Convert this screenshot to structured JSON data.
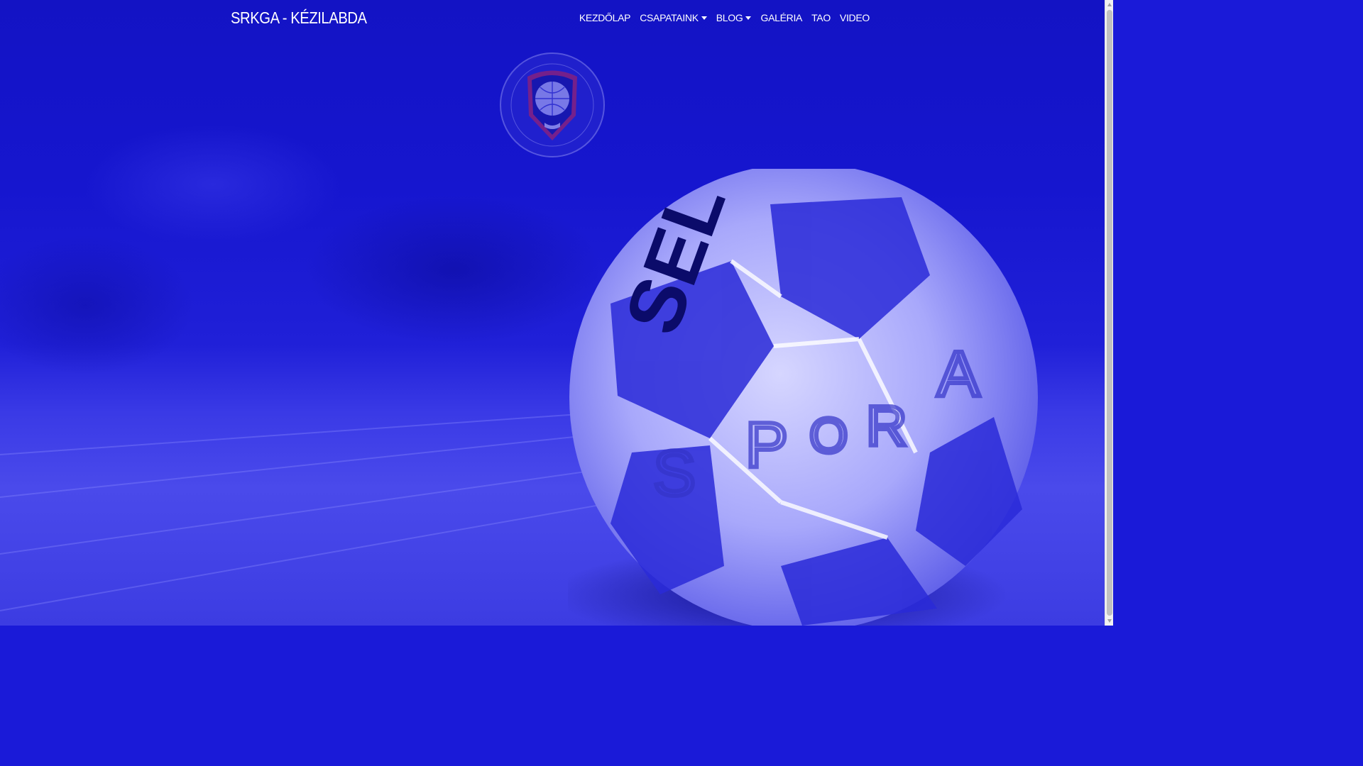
{
  "navbar": {
    "brand": "SRKGA - KÉZILABDA",
    "items": [
      {
        "label": "KEZDŐLAP",
        "dropdown": false
      },
      {
        "label": "CSAPATAINK",
        "dropdown": true
      },
      {
        "label": "BLOG",
        "dropdown": true
      },
      {
        "label": "GALÉRIA",
        "dropdown": false
      },
      {
        "label": "TAO",
        "dropdown": false
      },
      {
        "label": "VIDEO",
        "dropdown": false
      }
    ]
  },
  "hero": {
    "ball_text": [
      "SEL",
      "S",
      "P",
      "O",
      "R",
      "A"
    ]
  },
  "icons": {
    "caret": "chevron-down-icon",
    "logo": "club-crest-logo",
    "ball": "handball-image"
  },
  "colors": {
    "overlay": "#1a1ad8",
    "text": "#ffffff"
  }
}
